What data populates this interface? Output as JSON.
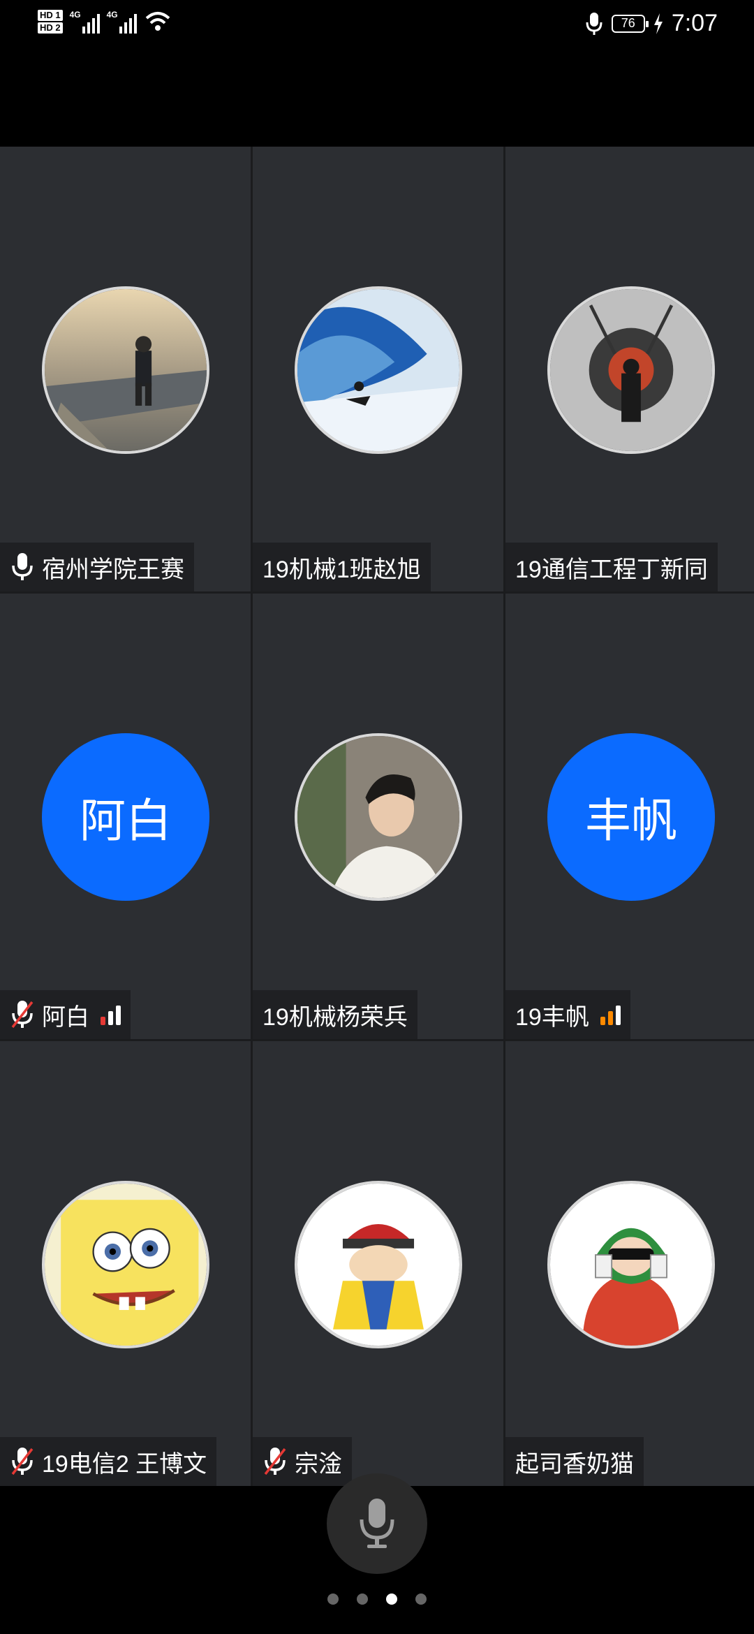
{
  "status_bar": {
    "sim1": "HD 1",
    "sim2": "HD 2",
    "network1": "4G",
    "network2": "4G",
    "battery": "76",
    "time": "7:07"
  },
  "participants": [
    {
      "name": "宿州学院王赛",
      "avatar": "photo-road",
      "mic": "on"
    },
    {
      "name": "19机械1班赵旭",
      "avatar": "photo-surf",
      "mic": "none"
    },
    {
      "name": "19通信工程丁新同",
      "avatar": "photo-dark",
      "mic": "none"
    },
    {
      "name": "阿白",
      "avatar_text": "阿白",
      "mic": "muted",
      "signal": "weak"
    },
    {
      "name": "19机械杨荣兵",
      "avatar": "photo-portrait",
      "mic": "none"
    },
    {
      "name": "19丰帆",
      "avatar_text": "丰帆",
      "mic": "none",
      "signal": "medium"
    },
    {
      "name": "19电信2 王博文",
      "avatar": "cartoon-sponge",
      "mic": "muted"
    },
    {
      "name": "宗淦",
      "avatar": "cartoon-emperor",
      "mic": "muted"
    },
    {
      "name": "起司香奶猫",
      "avatar": "cartoon-girl",
      "mic": "none"
    }
  ],
  "colors": {
    "accent": "#0b6bff",
    "tile": "#2c2e32",
    "muted": "#e53935",
    "signal_orange": "#ff8a00"
  },
  "pager": {
    "pages": 4,
    "current": 3
  }
}
